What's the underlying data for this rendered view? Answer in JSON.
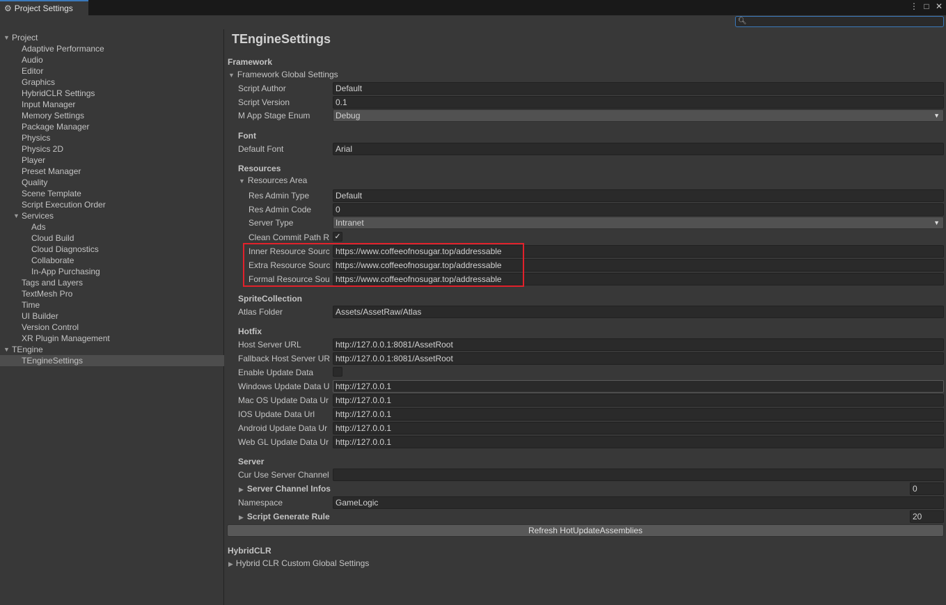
{
  "window": {
    "tab_title": "Project Settings",
    "icons": [
      "more-icon",
      "maximize-icon",
      "close-icon"
    ]
  },
  "search": {
    "value": "",
    "placeholder": ""
  },
  "sidebar": {
    "project_label": "Project",
    "items": [
      "Adaptive Performance",
      "Audio",
      "Editor",
      "Graphics",
      "HybridCLR Settings",
      "Input Manager",
      "Memory Settings",
      "Package Manager",
      "Physics",
      "Physics 2D",
      "Player",
      "Preset Manager",
      "Quality",
      "Scene Template",
      "Script Execution Order"
    ],
    "services_label": "Services",
    "services_items": [
      "Ads",
      "Cloud Build",
      "Cloud Diagnostics",
      "Collaborate",
      "In-App Purchasing"
    ],
    "items_after": [
      "Tags and Layers",
      "TextMesh Pro",
      "Time",
      "UI Builder",
      "Version Control",
      "XR Plugin Management"
    ],
    "tengine_label": "TEngine",
    "tengine_items": [
      "TEngineSettings"
    ]
  },
  "main": {
    "title": "TEngineSettings",
    "framework_header": "Framework",
    "framework_global": "Framework Global Settings",
    "script_author": {
      "label": "Script Author",
      "value": "Default"
    },
    "script_version": {
      "label": "Script Version",
      "value": "0.1"
    },
    "app_stage": {
      "label": "M App Stage Enum",
      "value": "Debug"
    },
    "font_header": "Font",
    "default_font": {
      "label": "Default Font",
      "value": "Arial"
    },
    "resources_header": "Resources",
    "resources_area": "Resources Area",
    "res_admin_type": {
      "label": "Res Admin Type",
      "value": "Default"
    },
    "res_admin_code": {
      "label": "Res Admin Code",
      "value": "0"
    },
    "server_type": {
      "label": "Server Type",
      "value": "Intranet"
    },
    "clean_commit": {
      "label": "Clean Commit Path R",
      "checked": "✓"
    },
    "inner_resource": {
      "label": "Inner Resource Sourc",
      "value": "https://www.coffeeofnosugar.top/addressable"
    },
    "extra_resource": {
      "label": "Extra Resource Sourc",
      "value": "https://www.coffeeofnosugar.top/addressable"
    },
    "formal_resource": {
      "label": "Formal Resource Sou",
      "value": "https://www.coffeeofnosugar.top/addressable"
    },
    "sprite_header": "SpriteCollection",
    "atlas_folder": {
      "label": "Atlas Folder",
      "value": "Assets/AssetRaw/Atlas"
    },
    "hotfix_header": "Hotfix",
    "host_server": {
      "label": "Host Server URL",
      "value": "http://127.0.0.1:8081/AssetRoot"
    },
    "fallback_host": {
      "label": "Fallback Host Server UR",
      "value": "http://127.0.0.1:8081/AssetRoot"
    },
    "enable_update": {
      "label": "Enable Update Data"
    },
    "windows_update": {
      "label": "Windows Update Data U",
      "value": "http://127.0.0.1"
    },
    "mac_update": {
      "label": "Mac OS Update Data Ur",
      "value": "http://127.0.0.1"
    },
    "ios_update": {
      "label": "IOS Update Data Url",
      "value": "http://127.0.0.1"
    },
    "android_update": {
      "label": "Android Update Data Ur",
      "value": "http://127.0.0.1"
    },
    "webgl_update": {
      "label": "Web GL Update Data Ur",
      "value": "http://127.0.0.1"
    },
    "server_header": "Server",
    "cur_use_server": {
      "label": "Cur Use Server Channel",
      "value": ""
    },
    "server_channel_infos": {
      "label": "Server Channel Infos",
      "count": "0"
    },
    "namespace": {
      "label": "Namespace",
      "value": "GameLogic"
    },
    "script_generate_rule": {
      "label": "Script Generate Rule",
      "count": "20"
    },
    "refresh_button": "Refresh HotUpdateAssemblies",
    "hybridclr_header": "HybridCLR",
    "hybridclr_custom": "Hybrid CLR Custom Global Settings"
  }
}
